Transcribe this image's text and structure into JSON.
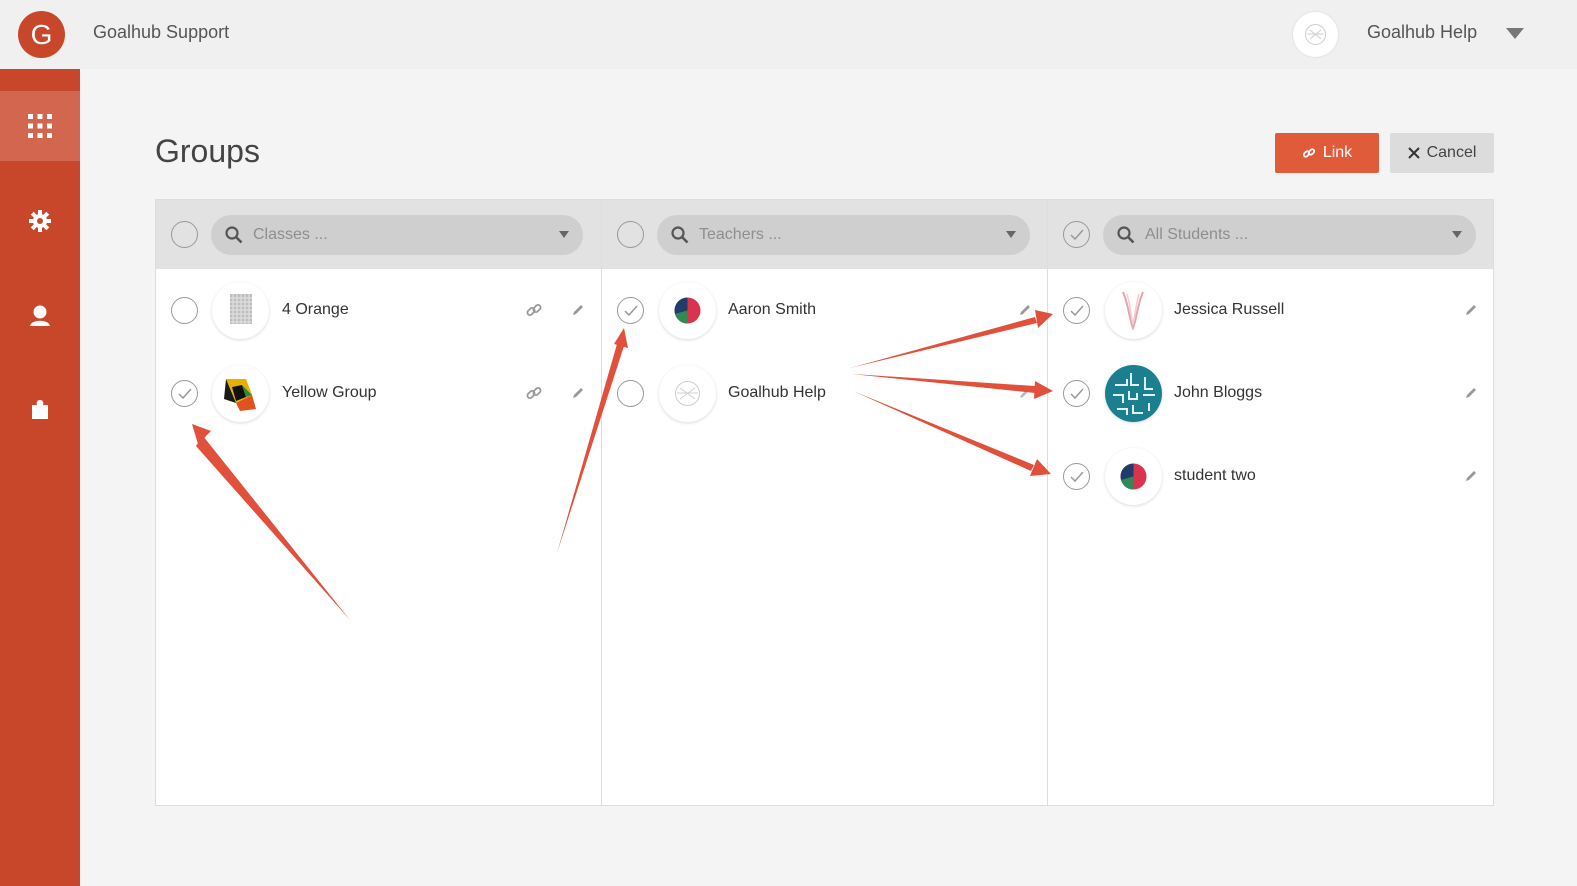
{
  "header": {
    "brand_letter": "G",
    "brand_name": "Goalhub Support",
    "user_name": "Goalhub Help"
  },
  "sidebar": {
    "items": [
      {
        "icon": "grid-icon",
        "active": true
      },
      {
        "icon": "gear-icon",
        "active": false
      },
      {
        "icon": "user-icon",
        "active": false
      },
      {
        "icon": "puzzle-icon",
        "active": false
      }
    ]
  },
  "page": {
    "title": "Groups",
    "link_label": "Link",
    "cancel_label": "Cancel"
  },
  "columns": {
    "classes": {
      "placeholder": "Classes ...",
      "items": [
        {
          "name": "4 Orange",
          "checked": false
        },
        {
          "name": "Yellow Group",
          "checked": true
        }
      ]
    },
    "teachers": {
      "placeholder": "Teachers ...",
      "items": [
        {
          "name": "Aaron Smith",
          "checked": true
        },
        {
          "name": "Goalhub Help",
          "checked": false
        }
      ]
    },
    "students": {
      "placeholder": "All Students ...",
      "items": [
        {
          "name": "Jessica Russell",
          "checked": true
        },
        {
          "name": "John Bloggs",
          "checked": true
        },
        {
          "name": "student two",
          "checked": true
        }
      ]
    }
  },
  "colors": {
    "accent": "#c8472a",
    "button": "#e05b3a",
    "annotation_arrow": "#e0503a"
  }
}
